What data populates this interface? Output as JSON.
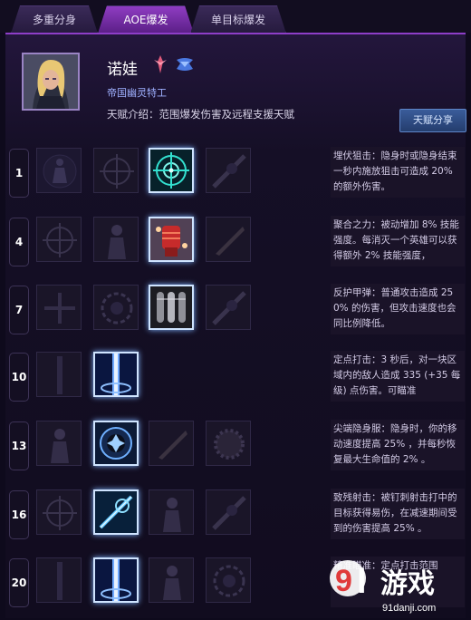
{
  "tabs": [
    {
      "label": "多重分身",
      "active": false
    },
    {
      "label": "AOE爆发",
      "active": true
    },
    {
      "label": "单目标爆发",
      "active": false
    }
  ],
  "hero": {
    "name": "诺娃",
    "title": "帝国幽灵特工",
    "intro": "天赋介绍：范围爆发伤害及远程支援天赋"
  },
  "share_button": "天赋分享",
  "talent_rows": [
    {
      "level": "1",
      "selected_index": 2,
      "icons": [
        "silhouette-icon",
        "crosshair-dark-icon",
        "crosshair-glow-icon",
        "scope-dark-icon"
      ],
      "description": "埋伏狙击：隐身时或隐身结束一秒内施放狙击可造成 20% 的额外伤害。"
    },
    {
      "level": "4",
      "selected_index": 2,
      "icons": [
        "crosshair-dark-icon",
        "figure-dark-icon",
        "power-fist-icon",
        "blade-dark-icon"
      ],
      "description": "聚合之力：被动增加 8% 技能强度。每消灭一个英雄可以获得额外 2% 技能强度，"
    },
    {
      "level": "7",
      "selected_index": 2,
      "icons": [
        "cross-dark-icon",
        "ring-dark-icon",
        "armored-bullets-icon",
        "scope-dark-icon"
      ],
      "description": "反护甲弹：普通攻击造成 250% 的伤害，但攻击速度也会同比例降低。"
    },
    {
      "level": "10",
      "selected_index": 1,
      "icons": [
        "streak-dark-icon",
        "precision-strike-icon"
      ],
      "description": "定点打击：3 秒后，对一块区域内的敌人造成 335 (+35 每级) 点伤害。可瞄准"
    },
    {
      "level": "13",
      "selected_index": 1,
      "icons": [
        "figure-dark-icon",
        "cloak-ring-icon",
        "blade-dark-icon",
        "gear-dark-icon"
      ],
      "description": "尖端隐身服：隐身时，你的移动速度提高 25% ，并每秒恢复最大生命值的 2% 。"
    },
    {
      "level": "16",
      "selected_index": 1,
      "icons": [
        "crosshair-dark-icon",
        "snipe-icon",
        "figure-dark-icon",
        "scope-dark-icon"
      ],
      "description": "致残射击：被钉刺射击打中的目标获得易伤，在减速期间受到的伤害提高 25% 。"
    },
    {
      "level": "20",
      "selected_index": 1,
      "icons": [
        "streak-dark-icon",
        "precision-strike-icon",
        "figure-dark-icon",
        "ring-dark-icon"
      ],
      "description": "精准瞄准：定点打击范围"
    }
  ],
  "watermark": {
    "logo_text": "游戏",
    "site": "91danji.com"
  }
}
